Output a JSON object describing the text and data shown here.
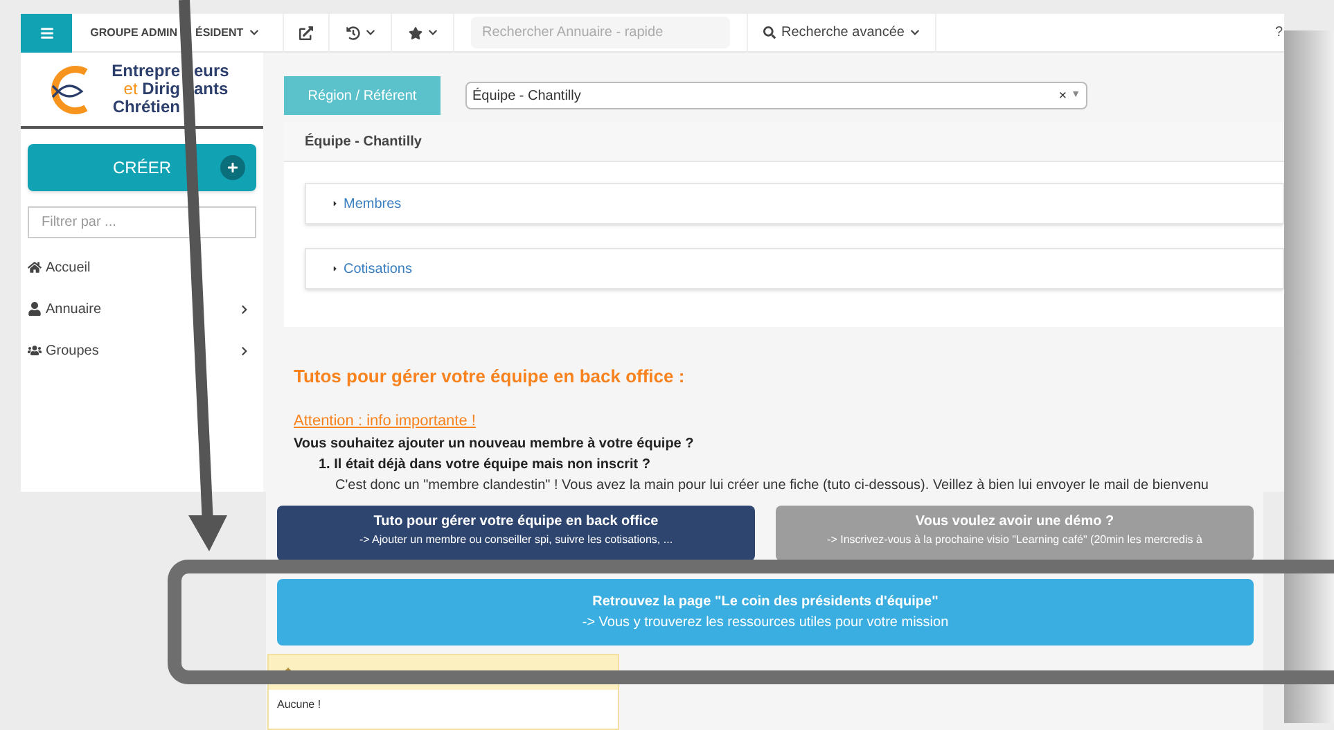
{
  "topbar": {
    "group_start": "GROUPE ADMIN",
    "group_end": "ÉSIDENT",
    "search": {
      "placeholder": "Rechercher Annuaire - rapide"
    },
    "advanced_search": "Recherche avancée",
    "help": "?"
  },
  "sidebar": {
    "logo": {
      "line1_start": "Entrepre",
      "line1_end": "eurs",
      "line2a": "et",
      "line2b_start": "Dirig",
      "line2b_end": "ants",
      "line3": "Chrétien"
    },
    "create_button": "CRÉER",
    "filter": {
      "placeholder": "Filtrer par ..."
    },
    "items": [
      {
        "kind": "home",
        "label": "Accueil",
        "expandable": false
      },
      {
        "kind": "user",
        "label": "Annuaire",
        "expandable": true
      },
      {
        "kind": "users",
        "label": "Groupes",
        "expandable": true
      }
    ]
  },
  "filter_bar": {
    "button": "Région / Référent",
    "select": {
      "value": "Équipe - Chantilly",
      "clear": "×",
      "arrow": "▼"
    }
  },
  "panel": {
    "title": "Équipe - Chantilly",
    "sections": [
      {
        "label": "Membres",
        "expanded": false
      },
      {
        "label": "Cotisations",
        "expanded": false
      }
    ]
  },
  "tutorial": {
    "title": "Tutos pour gérer votre équipe en back office :",
    "warning": "Attention : info importante !",
    "question": "Vous souhaitez ajouter un nouveau membre à votre équipe ?",
    "list": [
      {
        "number": "1.",
        "title": "Il était déjà dans votre équipe mais non inscrit ?",
        "text": "C'est donc un \"membre clandestin\" ! Vous avez la main pour lui créer une fiche (tuto ci-dessous). Veillez à bien lui envoyer le mail de bienvenu"
      }
    ]
  },
  "cards": [
    {
      "title": "Tuto pour gérer votre équipe en back office",
      "text": "-> Ajouter un membre ou conseiller spi, suivre les cotisations, ...",
      "color": "#2e4570"
    },
    {
      "title": "Vous voulez avoir une démo ?",
      "text": "-> Inscrivez-vous à la prochaine visio \"Learning café\" (20min les mercredis à",
      "color": "#9d9d9d"
    }
  ],
  "banner": {
    "title": "Retrouvez la page \"Le coin des présidents d'équipe\"",
    "text": "-> Vous y trouverez les ressources utiles pour votre mission"
  },
  "alerts": {
    "body": "Aucune !"
  }
}
